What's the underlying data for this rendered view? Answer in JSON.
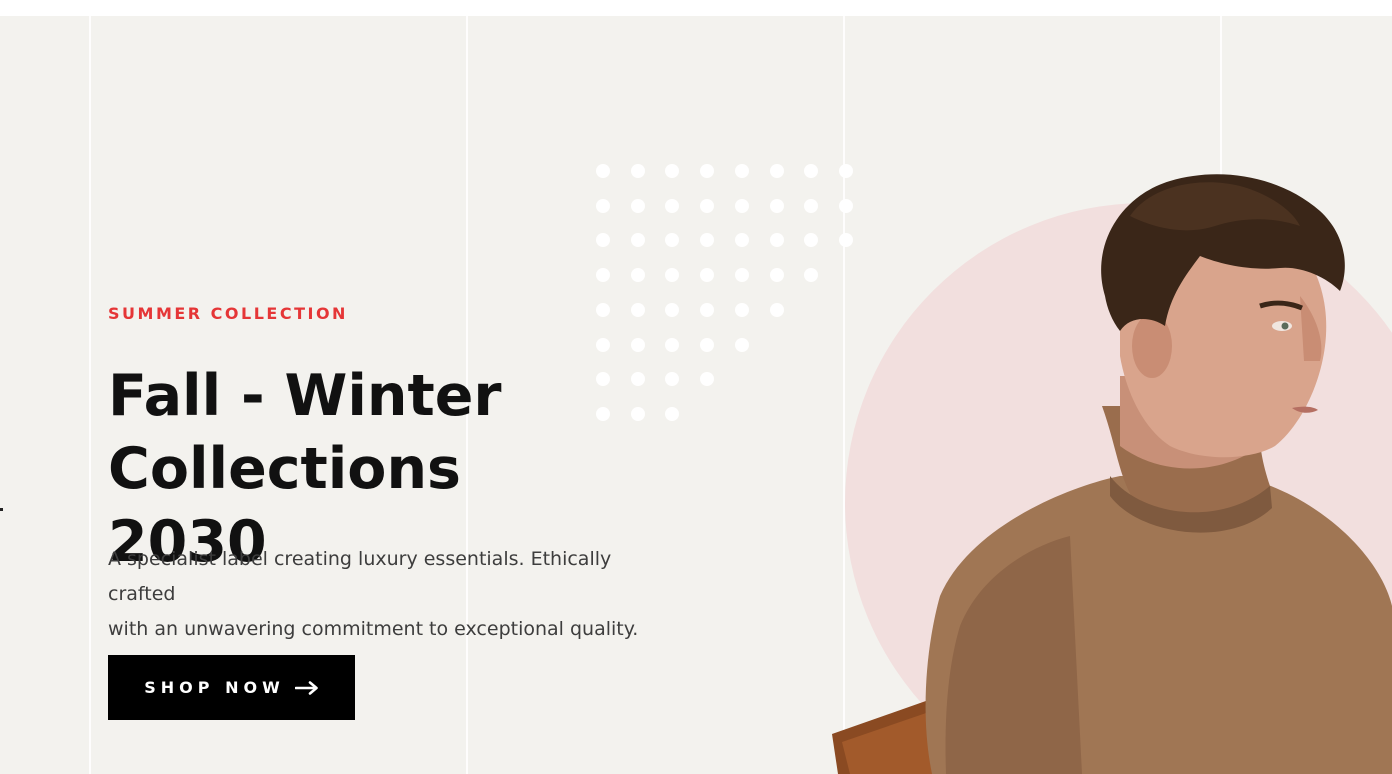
{
  "hero": {
    "eyebrow": "SUMMER COLLECTION",
    "title_line1": "Fall - Winter",
    "title_line2": "Collections 2030",
    "description_line1": "A specialist label creating luxury essentials. Ethically crafted",
    "description_line2": "with an unwavering commitment to exceptional quality.",
    "cta_label": "SHOP NOW",
    "cta_icon": "arrow-right-icon",
    "image_subject": "model-turtleneck-sweater"
  },
  "colors": {
    "accent": "#e53637",
    "background": "#f3f2ee",
    "button": "#000000",
    "circle": "#f2dfde"
  }
}
